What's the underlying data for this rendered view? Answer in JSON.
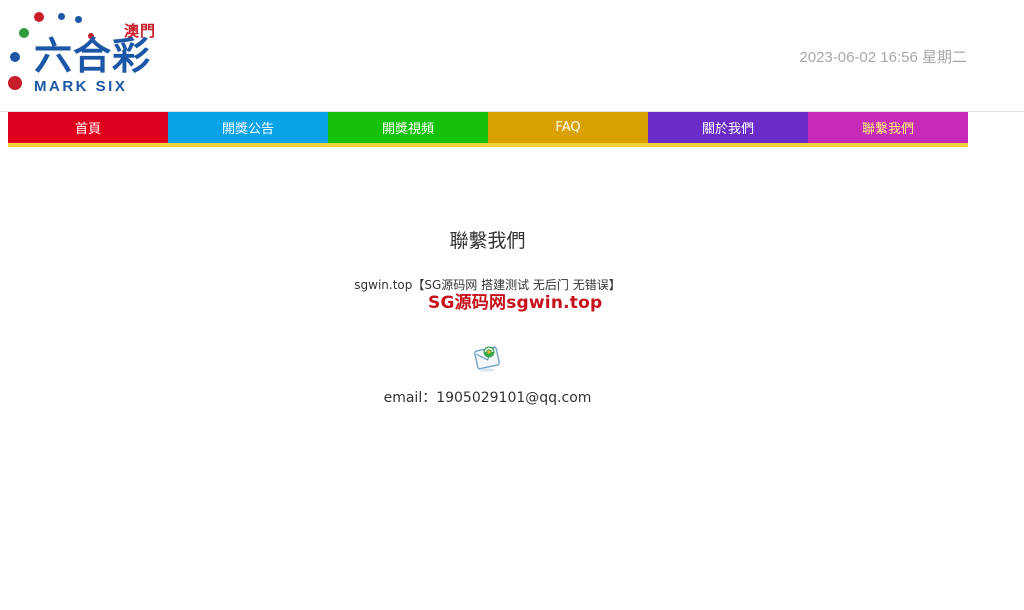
{
  "header": {
    "logo": {
      "region": "澳門",
      "name": "六合彩",
      "subtitle": "MARK SIX"
    },
    "datetime": "2023-06-02 16:56 星期二"
  },
  "nav": {
    "items": [
      {
        "label": "首頁",
        "color": "#e0001e"
      },
      {
        "label": "開獎公告",
        "color": "#0aa3e8"
      },
      {
        "label": "開獎視頻",
        "color": "#16c10b"
      },
      {
        "label": "FAQ",
        "color": "#d9a100"
      },
      {
        "label": "關於我們",
        "color": "#6a2bc7"
      },
      {
        "label": "聯繫我們",
        "color": "#c72ab8"
      }
    ],
    "active_index": 5,
    "underline_color": "#f3d33a"
  },
  "main": {
    "title": "聯繫我們",
    "description": "sgwin.top【SG源码网 搭建测试 无后门 无错误】",
    "watermark": "SG源码网sgwin.top",
    "mail_icon": "envelope-icon",
    "email": "email：1905029101@qq.com"
  }
}
